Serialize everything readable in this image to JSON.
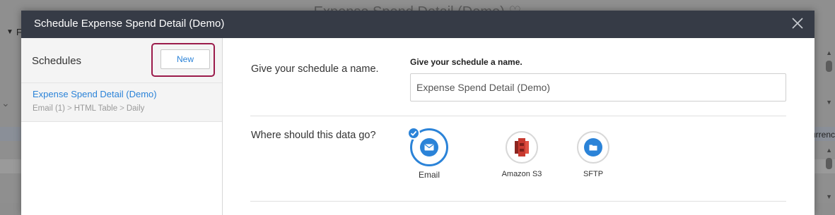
{
  "background": {
    "page_title": "Expense Spend Detail (Demo)",
    "left_label": "F",
    "right_label": "urrenc"
  },
  "modal": {
    "title": "Schedule Expense Spend Detail (Demo)"
  },
  "sidebar": {
    "title": "Schedules",
    "new_button": "New",
    "schedules": [
      {
        "name": "Expense Spend Detail (Demo)",
        "meta": [
          "Email (1)",
          "HTML Table",
          "Daily"
        ]
      }
    ]
  },
  "main": {
    "name_question": "Give your schedule a name.",
    "name_field_label": "Give your schedule a name.",
    "name_value": "Expense Spend Detail (Demo)",
    "destination_question": "Where should this data go?",
    "destinations": [
      {
        "label": "Email",
        "icon": "email-icon",
        "selected": true
      },
      {
        "label": "Amazon S3",
        "icon": "amazon-s3-icon",
        "selected": false
      },
      {
        "label": "SFTP",
        "icon": "folder-icon",
        "selected": false
      }
    ]
  },
  "colors": {
    "accent": "#2b83d8",
    "header_bg": "#363b46",
    "highlight": "#9b1b4b",
    "s3_red": "#c7392f"
  }
}
